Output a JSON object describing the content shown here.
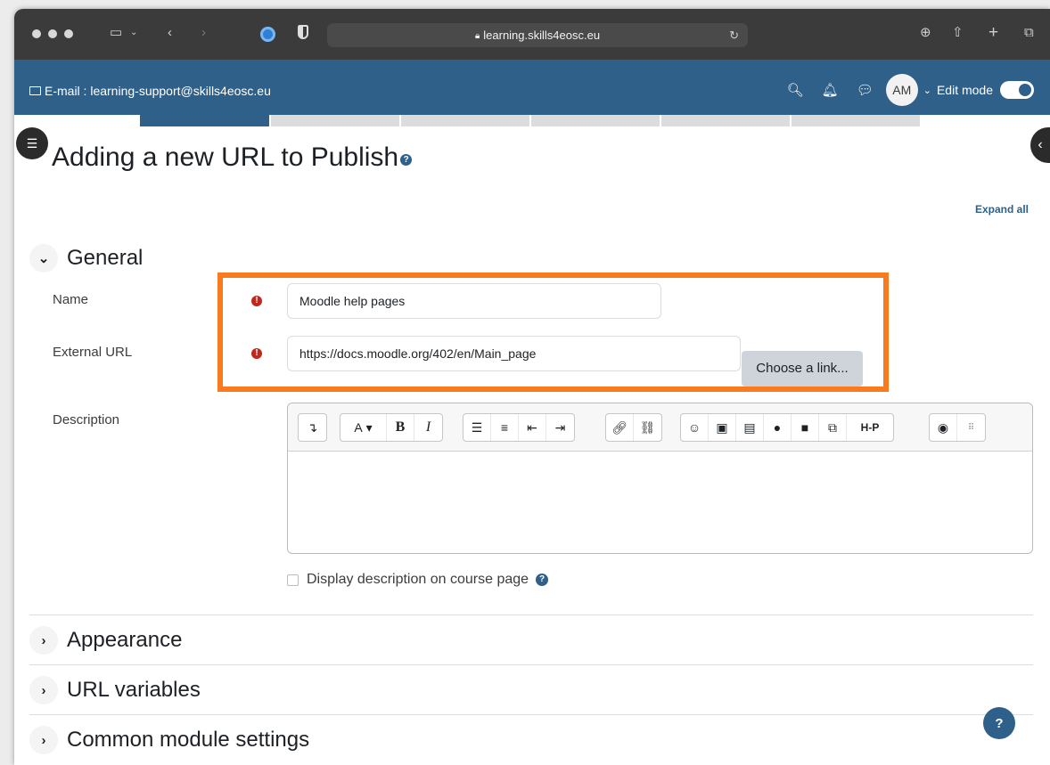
{
  "browser": {
    "url": "learning.skills4eosc.eu"
  },
  "navbar": {
    "email": "E-mail : learning-support@skills4eosc.eu",
    "avatar_initials": "AM",
    "edit_mode_label": "Edit mode",
    "edit_mode_on": true
  },
  "page": {
    "title": "Adding a new URL to Publish",
    "expand_all": "Expand all"
  },
  "general": {
    "heading": "General",
    "name_label": "Name",
    "name_value": "Moodle help pages",
    "url_label": "External URL",
    "url_value": "https://docs.moodle.org/402/en/Main_page",
    "choose_link": "Choose a link...",
    "description_label": "Description",
    "display_description_label": "Display description on course page"
  },
  "editor_toolbar": {
    "h5p_label": "H-P",
    "font_label": "A",
    "bold_label": "B",
    "italic_label": "I"
  },
  "sections": [
    {
      "label": "Appearance"
    },
    {
      "label": "URL variables"
    },
    {
      "label": "Common module settings"
    }
  ],
  "colors": {
    "brand": "#2e6089",
    "highlight": "#f97a1f",
    "required": "#c0281d"
  }
}
